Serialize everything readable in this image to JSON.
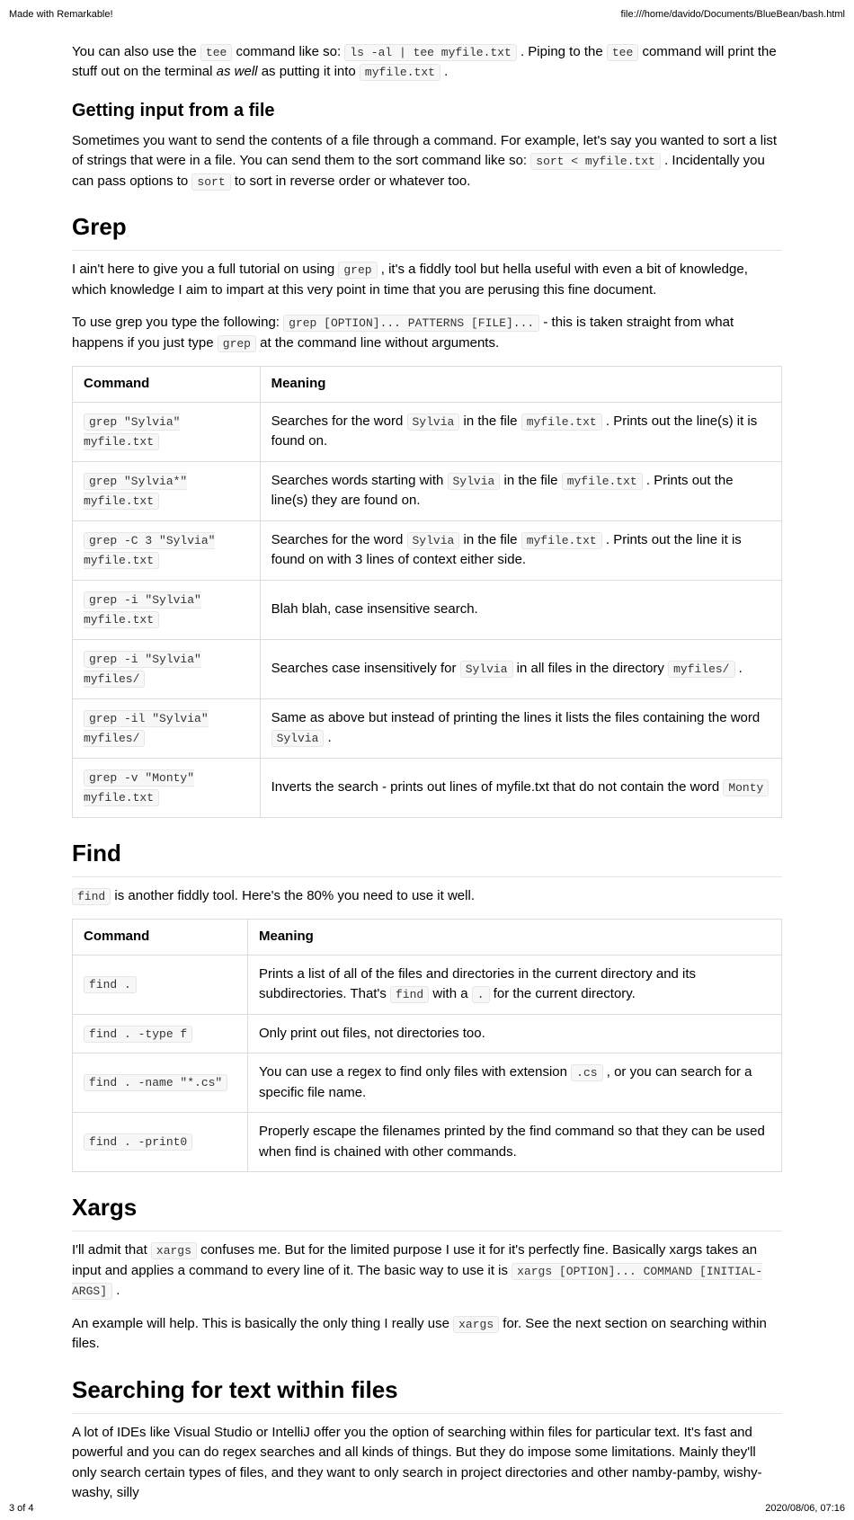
{
  "header": {
    "left": "Made with Remarkable!",
    "right": "file:///home/davido/Documents/BlueBean/bash.html"
  },
  "tee": {
    "p1_a": "You can also use the ",
    "c1": "tee",
    "p1_b": " command like so: ",
    "c2": "ls -al | tee myfile.txt",
    "p1_c": " . Piping to the ",
    "c3": "tee",
    "p1_d": " command will print the stuff out on the terminal ",
    "ital": "as well",
    "p1_e": " as putting it into ",
    "c4": "myfile.txt",
    "p1_f": " ."
  },
  "input_file": {
    "heading": "Getting input from a file",
    "p1_a": "Sometimes you want to send the contents of a file through a command. For example, let's say you wanted to sort a list of strings that were in a file. You can send them to the sort command like so: ",
    "c1": "sort < myfile.txt",
    "p1_b": " . Incidentally you can pass options to ",
    "c2": "sort",
    "p1_c": " to sort in reverse order or whatever too."
  },
  "grep": {
    "heading": "Grep",
    "p1_a": "I ain't here to give you a full tutorial on using ",
    "c1": "grep",
    "p1_b": " , it's a fiddly tool but hella useful with even a bit of knowledge, which knowledge I aim to impart at this very point in time that you are perusing this fine document.",
    "p2_a": "To use grep you type the following: ",
    "c2": "grep [OPTION]... PATTERNS [FILE]...",
    "p2_b": " - this is taken straight from what happens if you just type ",
    "c3": "grep",
    "p2_c": " at the command line without arguments.",
    "th1": "Command",
    "th2": "Meaning",
    "rows": [
      {
        "cmd": "grep \"Sylvia\" myfile.txt",
        "m": [
          {
            "t": "Searches for the word "
          },
          {
            "c": "Sylvia"
          },
          {
            "t": " in the file "
          },
          {
            "c": "myfile.txt"
          },
          {
            "t": " . Prints out the line(s) it is found on."
          }
        ]
      },
      {
        "cmd": "grep \"Sylvia*\" myfile.txt",
        "m": [
          {
            "t": "Searches words starting with "
          },
          {
            "c": "Sylvia"
          },
          {
            "t": " in the file "
          },
          {
            "c": "myfile.txt"
          },
          {
            "t": " . Prints out the line(s) they are found on."
          }
        ]
      },
      {
        "cmd": "grep -C 3 \"Sylvia\" myfile.txt",
        "m": [
          {
            "t": "Searches for the word "
          },
          {
            "c": "Sylvia"
          },
          {
            "t": " in the file "
          },
          {
            "c": "myfile.txt"
          },
          {
            "t": " . Prints out the line it is found on with 3 lines of context either side."
          }
        ]
      },
      {
        "cmd": "grep -i \"Sylvia\" myfile.txt",
        "m": [
          {
            "t": "Blah blah, case insensitive search."
          }
        ]
      },
      {
        "cmd": "grep -i \"Sylvia\" myfiles/",
        "m": [
          {
            "t": "Searches case insensitively for "
          },
          {
            "c": "Sylvia"
          },
          {
            "t": " in all files in the directory "
          },
          {
            "c": "myfiles/"
          },
          {
            "t": " ."
          }
        ]
      },
      {
        "cmd": "grep -il \"Sylvia\" myfiles/",
        "m": [
          {
            "t": "Same as above but instead of printing the lines it lists the files containing the word "
          },
          {
            "c": "Sylvia"
          },
          {
            "t": " ."
          }
        ]
      },
      {
        "cmd": "grep -v \"Monty\" myfile.txt",
        "m": [
          {
            "t": "Inverts the search - prints out lines of myfile.txt that do not contain the word "
          },
          {
            "c": "Monty"
          }
        ]
      }
    ]
  },
  "find": {
    "heading": "Find",
    "p1_a": "",
    "c1": "find",
    "p1_b": " is another fiddly tool. Here's the 80% you need to use it well.",
    "th1": "Command",
    "th2": "Meaning",
    "rows": [
      {
        "cmd": "find .",
        "m": [
          {
            "t": "Prints a list of all of the files and directories in the current directory and its subdirectories. That's "
          },
          {
            "c": "find"
          },
          {
            "t": " with a "
          },
          {
            "c": "."
          },
          {
            "t": " for the current directory."
          }
        ]
      },
      {
        "cmd": "find . -type f",
        "m": [
          {
            "t": "Only print out files, not directories too."
          }
        ]
      },
      {
        "cmd": "find . -name \"*.cs\"",
        "m": [
          {
            "t": "You can use a regex to find only files with extension "
          },
          {
            "c": ".cs"
          },
          {
            "t": " , or you can search for a specific file name."
          }
        ]
      },
      {
        "cmd": "find . -print0",
        "m": [
          {
            "t": "Properly escape the filenames printed by the find command so that they can be used when find is chained with other commands."
          }
        ]
      }
    ]
  },
  "xargs": {
    "heading": "Xargs",
    "p1_a": "I'll admit that ",
    "c1": "xargs",
    "p1_b": " confuses me. But for the limited purpose I use it for it's perfectly fine. Basically xargs takes an input and applies a command to every line of it. The basic way to use it is ",
    "c2": "xargs [OPTION]... COMMAND [INITIAL-ARGS]",
    "p1_c": " .",
    "p2_a": "An example will help. This is basically the only thing I really use ",
    "c3": "xargs",
    "p2_b": " for. See the next section on searching within files."
  },
  "search": {
    "heading": "Searching for text within files",
    "p1": "A lot of IDEs like Visual Studio or IntelliJ offer you the option of searching within files for particular text. It's fast and powerful and you can do regex searches and all kinds of things. But they do impose some limitations. Mainly they'll only search certain types of files, and they want to only search in project directories and other namby-pamby, wishy-washy, silly"
  },
  "footer": {
    "left": "3 of 4",
    "right": "2020/08/06, 07:16"
  }
}
